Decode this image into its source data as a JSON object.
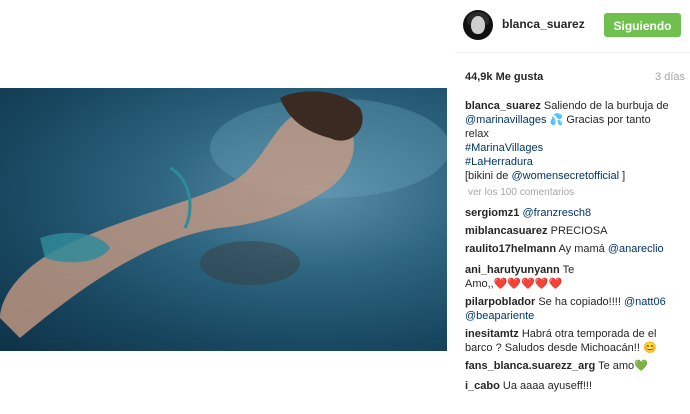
{
  "post": {
    "username": "blanca_suarez",
    "follow_label": "Siguiendo",
    "likes": "44,9k Me gusta",
    "time_ago": "3 días",
    "caption": {
      "username": "blanca_suarez",
      "text_1": "Saliendo de la burbuja de",
      "mention_1": "@marinavillages",
      "bubble_emoji": "💦",
      "text_2": "Gracias por tanto",
      "text_3": "relax",
      "hashtag_1": "#MarinaVillages",
      "hashtag_2": "#LaHerradura",
      "bikini_prefix": "[bikini de",
      "mention_2": "@womensecretofficial",
      "bikini_suffix": "]"
    },
    "view_comments": "ver los 100 comentarios"
  },
  "comments": [
    {
      "user": "sergiomz1",
      "mention": "@franzresch8"
    },
    {
      "user": "miblancasuarez",
      "text": "PRECIOSA"
    },
    {
      "user": "raulito17helmann",
      "text": "Ay mamá",
      "mention": "@anareclio"
    },
    {
      "user": "ani_harutyunyann",
      "text": "Te",
      "text_2": "Amo,,",
      "hearts": "❤️❤️❤️❤️❤️"
    },
    {
      "user": "pilarpoblador",
      "text": "Se ha copiado!!!!",
      "mention": "@natt06",
      "mention_2": "@beapariente"
    },
    {
      "user": "inesitamtz",
      "text": "Habrá otra temporada de el",
      "text_2": "barco ? Saludos desde Michoacán!!",
      "emoji": "😊"
    },
    {
      "user": "fans_blanca.suarezz_arg",
      "text": "Te amo",
      "emoji": "💚"
    },
    {
      "user": "i_cabo",
      "text": "Ua aaaa ayuseff!!!"
    }
  ],
  "colors": {
    "follow_button": "#70c050",
    "link": "#003569",
    "muted": "#a5a7aa"
  }
}
